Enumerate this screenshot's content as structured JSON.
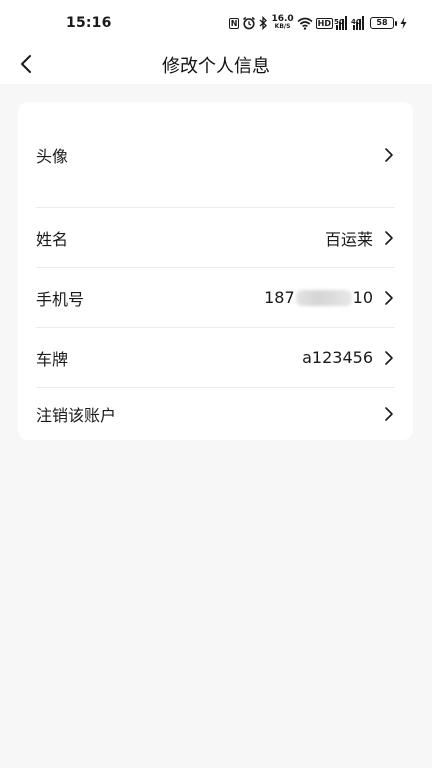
{
  "status_bar": {
    "time": "15:16",
    "nfc_icon": "N",
    "network_speed_value": "16.0",
    "network_speed_unit": "KB/S",
    "hd_badge": "HD",
    "signal1_type": "5G",
    "signal2_type": "4G",
    "battery_level": "58"
  },
  "header": {
    "title": "修改个人信息",
    "back_icon": "chevron-left-icon"
  },
  "profile": {
    "rows": [
      {
        "label": "头像",
        "value": ""
      },
      {
        "label": "姓名",
        "value": "百运莱"
      },
      {
        "label": "手机号",
        "value_prefix": "187",
        "value_suffix": "10"
      },
      {
        "label": "车牌",
        "value": "a123456"
      },
      {
        "label": "注销该账户",
        "value": ""
      }
    ]
  }
}
